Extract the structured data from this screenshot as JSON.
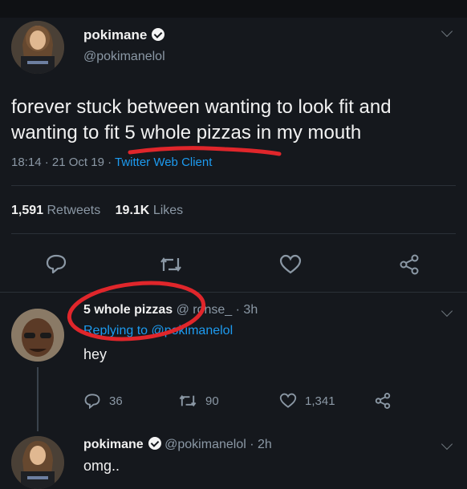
{
  "main_tweet": {
    "display_name": "pokimane",
    "handle": "@pokimanelol",
    "text_line1": "forever stuck between wanting to look fit and",
    "text_line2": "wanting to fit 5 whole pizzas in my mouth",
    "time": "18:14 · 21 Oct 19 ·",
    "client": "Twitter Web Client",
    "retweets_count": "1,591",
    "retweets_label": "Retweets",
    "likes_count": "19.1K",
    "likes_label": "Likes"
  },
  "reply": {
    "display_name": "5 whole pizzas",
    "handle_time": "@ ronse_ · 3h",
    "replying_to": "Replying to @pokimanelol",
    "text": "hey",
    "comments": "36",
    "retweets": "90",
    "likes": "1,341"
  },
  "reply2": {
    "display_name": "pokimane",
    "handle_time": "@pokimanelol · 2h",
    "text": "omg.."
  },
  "colors": {
    "background": "#15181d",
    "accent_blue": "#1d9bf0",
    "annotation_red": "#e0262b"
  },
  "icons": [
    "verified-badge-icon",
    "chevron-down-icon",
    "reply-icon",
    "retweet-icon",
    "like-icon",
    "share-icon"
  ]
}
